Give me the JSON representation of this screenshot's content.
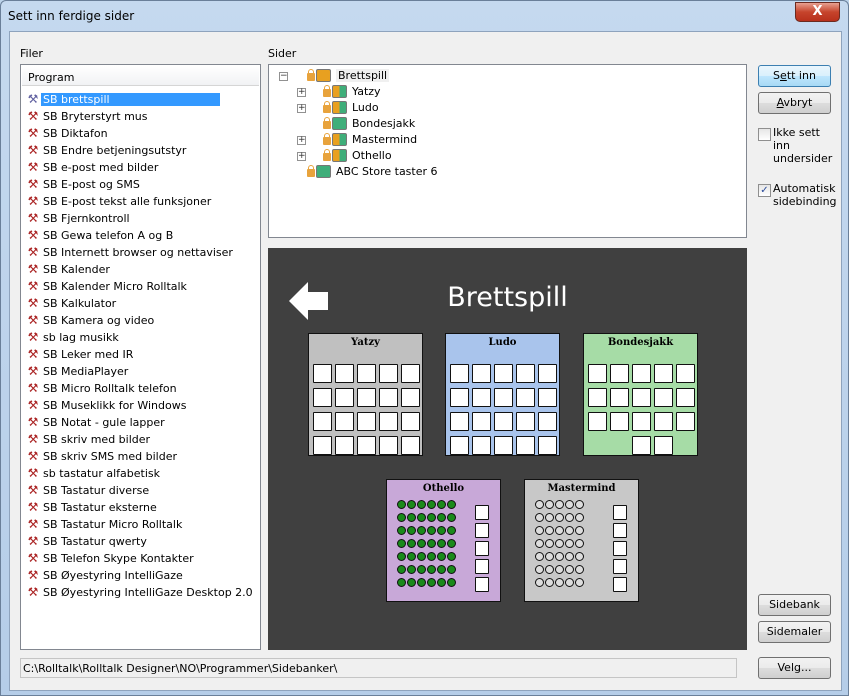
{
  "window": {
    "title": "Sett inn ferdige sider",
    "close_label": "X"
  },
  "files": {
    "label": "Filer",
    "header": "Program",
    "items": [
      "SB brettspill",
      "SB Bryterstyrt mus",
      "SB Diktafon",
      "SB Endre betjeningsutstyr",
      "SB e-post med bilder",
      "SB E-post og SMS",
      "SB E-post tekst alle funksjoner",
      "SB Fjernkontroll",
      "SB Gewa telefon A og B",
      "SB Internett browser og nettaviser",
      "SB Kalender",
      "SB Kalender Micro Rolltalk",
      "SB Kalkulator",
      "SB Kamera og video",
      "sb lag musikk",
      "SB Leker med IR",
      "SB MediaPlayer",
      "SB Micro Rolltalk telefon",
      "SB Museklikk for Windows",
      "SB Notat - gule lapper",
      "SB skriv med bilder",
      "SB skriv SMS med bilder",
      "sb tastatur alfabetisk",
      "SB Tastatur diverse",
      "SB Tastatur eksterne",
      "SB Tastatur Micro Rolltalk",
      "SB Tastatur qwerty",
      "SB Telefon Skype Kontakter",
      "SB Øyestyring IntelliGaze",
      "SB Øyestyring IntelliGaze Desktop 2.0"
    ],
    "selected": "SB brettspill"
  },
  "pages": {
    "label": "Sider",
    "tree": [
      {
        "label": "Brettspill",
        "level": 0,
        "expander": "-",
        "color": "#e8a020"
      },
      {
        "label": "Yatzy",
        "level": 1,
        "expander": "+",
        "color": "#e8a020"
      },
      {
        "label": "Ludo",
        "level": 1,
        "expander": "+",
        "color": "#e8a020"
      },
      {
        "label": "Bondesjakk",
        "level": 1,
        "expander": "",
        "color": "#3fae7a"
      },
      {
        "label": "Mastermind",
        "level": 1,
        "expander": "+",
        "color": "#e8a020"
      },
      {
        "label": "Othello",
        "level": 1,
        "expander": "+",
        "color": "#e8a020"
      },
      {
        "label": "ABC Store taster 6",
        "level": 0,
        "expander": "",
        "color": "#3fae7a"
      }
    ]
  },
  "preview": {
    "title": "Brettspill",
    "thumbnails": [
      {
        "title": "Yatzy",
        "bg": "#c0c0c0"
      },
      {
        "title": "Ludo",
        "bg": "#a9c4ec"
      },
      {
        "title": "Bondesjakk",
        "bg": "#a6dca6"
      },
      {
        "title": "Othello",
        "bg": "#c8a8d8"
      },
      {
        "title": "Mastermind",
        "bg": "#c8c8c8"
      }
    ]
  },
  "buttons": {
    "insert": "Sett inn",
    "cancel": "Avbryt",
    "pagebank": "Sidebank",
    "templates": "Sidemaler",
    "choose": "Velg..."
  },
  "options": {
    "no_subpages": {
      "label": "Ikke sett inn undersider",
      "checked": false
    },
    "auto_binding": {
      "label": "Automatisk sidebinding",
      "checked": true
    }
  },
  "path": "C:\\Rolltalk\\Rolltalk Designer\\NO\\Programmer\\Sidebanker\\"
}
